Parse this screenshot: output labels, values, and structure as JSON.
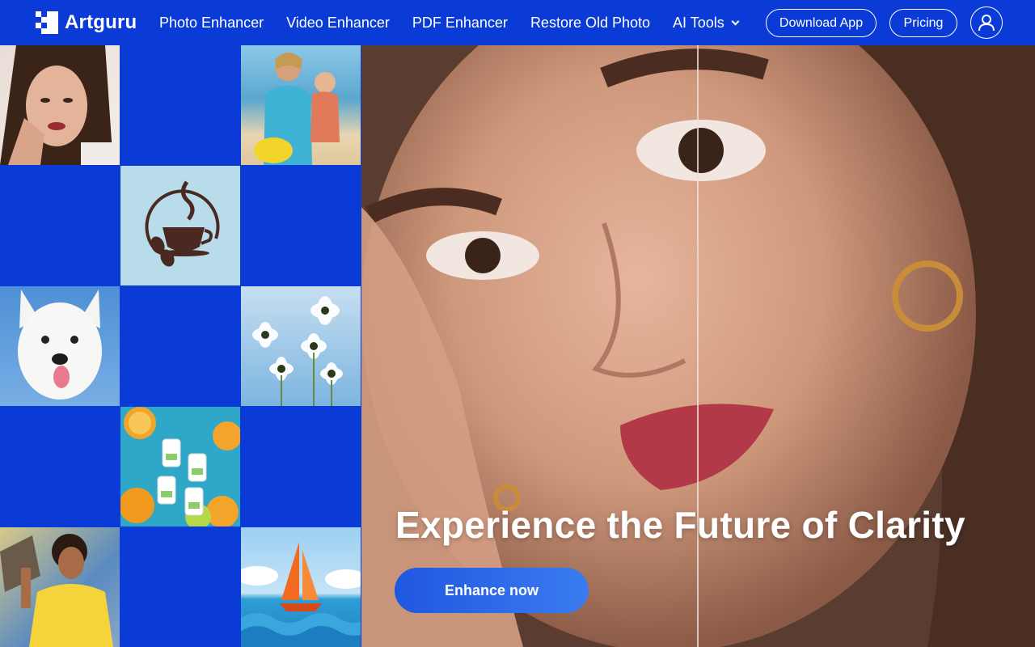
{
  "brand": {
    "name": "Artguru",
    "logo_icon": "pixel-grid-icon"
  },
  "nav": {
    "links": [
      {
        "label": "Photo Enhancer"
      },
      {
        "label": "Video Enhancer"
      },
      {
        "label": "PDF Enhancer"
      },
      {
        "label": "Restore Old Photo"
      },
      {
        "label": "AI Tools",
        "icon": "chevron-down-icon"
      }
    ],
    "download_label": "Download App",
    "pricing_label": "Pricing",
    "user_icon": "user-icon"
  },
  "hero": {
    "title": "Experience the Future of Clarity",
    "cta_label": "Enhance now",
    "comparison": "before-after-slider"
  },
  "mosaic": {
    "tiles": [
      {
        "subject": "portrait-woman"
      },
      {
        "subject": "mother-child-beach"
      },
      {
        "subject": "coffee-logo"
      },
      {
        "subject": "white-dog"
      },
      {
        "subject": "white-flowers"
      },
      {
        "subject": "nail-polish-citrus"
      },
      {
        "subject": "skateboarder"
      },
      {
        "subject": "sailboat-illustration"
      }
    ]
  },
  "colors": {
    "brand_blue": "#0a3bd6",
    "cta_blue": "#2a67e8",
    "text_white": "#ffffff"
  }
}
